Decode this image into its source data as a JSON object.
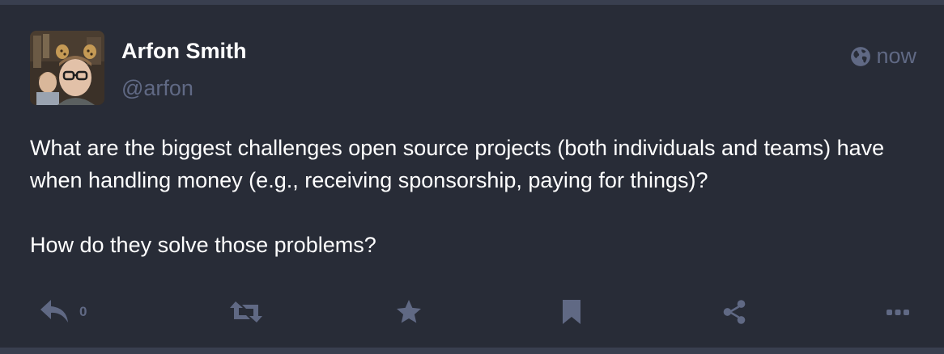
{
  "post": {
    "author": {
      "display_name": "Arfon Smith",
      "handle": "@arfon",
      "avatar_icon": "user-avatar-photo"
    },
    "visibility_icon": "globe-icon",
    "timestamp": "now",
    "content": {
      "paragraph_1": "What are the biggest challenges open source projects (both individuals and teams) have when handling money (e.g., receiving sponsorship, paying for things)?",
      "paragraph_2": "How do they solve those problems?"
    },
    "actions": {
      "reply_icon": "reply-icon",
      "reply_count": "0",
      "boost_icon": "retweet-icon",
      "favourite_icon": "star-icon",
      "bookmark_icon": "bookmark-icon",
      "share_icon": "share-icon",
      "more_icon": "ellipsis-icon"
    }
  },
  "colors": {
    "background": "#282c37",
    "muted": "#606984",
    "text": "#ffffff",
    "border": "#393f4f"
  }
}
